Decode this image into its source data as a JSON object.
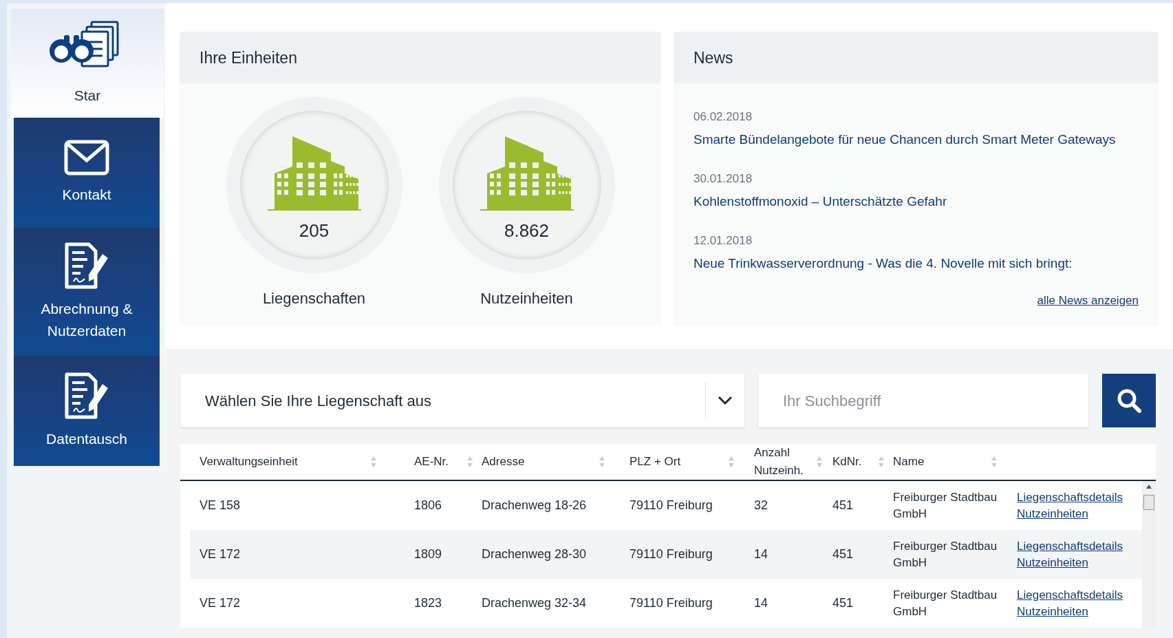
{
  "sidebar": {
    "items": [
      {
        "kind": "binoculars",
        "label": "Star",
        "selected": true
      },
      {
        "kind": "mail",
        "label": "Kontakt",
        "selected": false
      },
      {
        "kind": "document",
        "label": "Abrechnung & Nutzerdaten",
        "selected": false
      },
      {
        "kind": "document",
        "label": "Datentausch",
        "selected": false
      }
    ]
  },
  "units": {
    "title": "Ihre Einheiten",
    "items": [
      {
        "value": "205",
        "label": "Liegenschaften"
      },
      {
        "value": "8.862",
        "label": "Nutzeinheiten"
      }
    ]
  },
  "news": {
    "title": "News",
    "items": [
      {
        "date": "06.02.2018",
        "headline": "Smarte Bündelangebote für neue Chancen durch Smart Meter Gateways"
      },
      {
        "date": "30.01.2018",
        "headline": "Kohlenstoffmonoxid – Unterschätzte Gefahr"
      },
      {
        "date": "12.01.2018",
        "headline": "Neue Trinkwasserverordnung - Was die 4. Novelle mit sich bringt:"
      }
    ],
    "more_link": "alle News anzeigen"
  },
  "property_select": {
    "value": "Wählen Sie Ihre Liegenschaft aus"
  },
  "search": {
    "placeholder": "Ihr Suchbegriff"
  },
  "table": {
    "columns": [
      "Verwaltungseinheit",
      "AE-Nr.",
      "Adresse",
      "PLZ + Ort",
      "Anzahl Nutzeinh.",
      "KdNr.",
      "Name"
    ],
    "rows": [
      {
        "cells": [
          "VE 158",
          "1806",
          "Drachenweg 18-26",
          "79110 Freiburg",
          "32",
          "451",
          "Freiburger Stadtbau GmbH"
        ],
        "links": [
          "Liegenschaftsdetails",
          "Nutzeinheiten"
        ]
      },
      {
        "cells": [
          "VE 172",
          "1809",
          "Drachenweg 28-30",
          "79110 Freiburg",
          "14",
          "451",
          "Freiburger Stadtbau GmbH"
        ],
        "links": [
          "Liegenschaftsdetails",
          "Nutzeinheiten"
        ]
      },
      {
        "cells": [
          "VE 172",
          "1823",
          "Drachenweg 32-34",
          "79110 Freiburg",
          "14",
          "451",
          "Freiburger Stadtbau GmbH"
        ],
        "links": [
          "Liegenschaftsdetails",
          "Nutzeinheiten"
        ]
      }
    ]
  }
}
